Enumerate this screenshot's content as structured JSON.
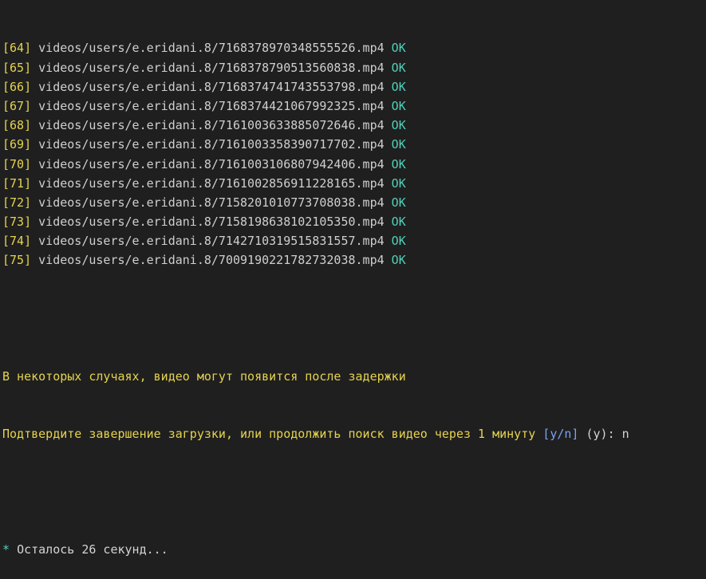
{
  "colors": {
    "background": "#1f1f1f",
    "index": "#e5d34f",
    "path": "#cfcfcf",
    "ok": "#4fd1b8",
    "message": "#e5d34f",
    "option": "#7aa2f7"
  },
  "download_log": [
    {
      "index": "[64]",
      "path": "videos/users/e.eridani.8/7168378970348555526.mp4",
      "status": "OK"
    },
    {
      "index": "[65]",
      "path": "videos/users/e.eridani.8/7168378790513560838.mp4",
      "status": "OK"
    },
    {
      "index": "[66]",
      "path": "videos/users/e.eridani.8/7168374741743553798.mp4",
      "status": "OK"
    },
    {
      "index": "[67]",
      "path": "videos/users/e.eridani.8/7168374421067992325.mp4",
      "status": "OK"
    },
    {
      "index": "[68]",
      "path": "videos/users/e.eridani.8/7161003633885072646.mp4",
      "status": "OK"
    },
    {
      "index": "[69]",
      "path": "videos/users/e.eridani.8/7161003358390717702.mp4",
      "status": "OK"
    },
    {
      "index": "[70]",
      "path": "videos/users/e.eridani.8/7161003106807942406.mp4",
      "status": "OK"
    },
    {
      "index": "[71]",
      "path": "videos/users/e.eridani.8/7161002856911228165.mp4",
      "status": "OK"
    },
    {
      "index": "[72]",
      "path": "videos/users/e.eridani.8/7158201010773708038.mp4",
      "status": "OK"
    },
    {
      "index": "[73]",
      "path": "videos/users/e.eridani.8/7158198638102105350.mp4",
      "status": "OK"
    },
    {
      "index": "[74]",
      "path": "videos/users/e.eridani.8/7142710319515831557.mp4",
      "status": "OK"
    },
    {
      "index": "[75]",
      "path": "videos/users/e.eridani.8/7009190221782732038.mp4",
      "status": "OK"
    }
  ],
  "notice": {
    "delay_message": "В некоторых случаях, видео могут появится после задержки",
    "confirm_prompt": "Подтвердите завершение загрузки, или продолжить поиск видео через 1 минуту",
    "options": "[y/n]",
    "default": "(y):",
    "user_input": "n"
  },
  "countdown": {
    "bullet": "*",
    "text": "Осталось 26 секунд..."
  }
}
